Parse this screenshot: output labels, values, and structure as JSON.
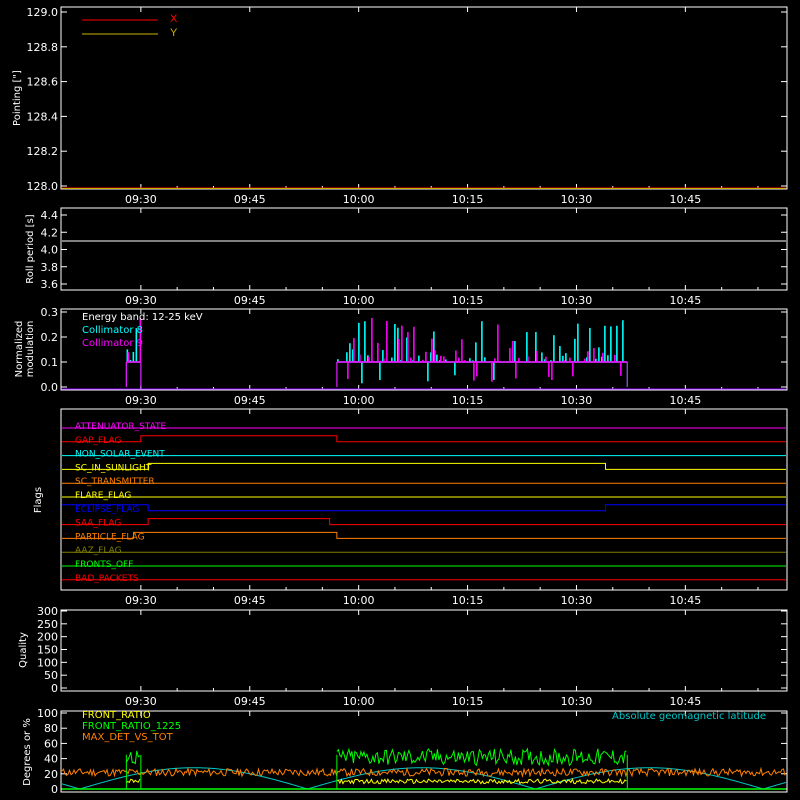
{
  "time_ticks": [
    "09:30",
    "09:45",
    "10:00",
    "10:15",
    "10:30",
    "10:45"
  ],
  "colors": {
    "x": "#ff0000",
    "y": "#c8b400",
    "roll": "#ffffff",
    "c8": "#00ffff",
    "c9": "#ff00ff",
    "base": "#8800ff",
    "fr": "#ffff00",
    "fr1225": "#00ff00",
    "maxdet": "#ff8000",
    "lat": "#00c8c8"
  },
  "chart_data": [
    {
      "type": "line",
      "ylabel": "Pointing [\"]",
      "ylim": [
        128.0,
        129.0
      ],
      "yticks": [
        "129.0",
        "128.8",
        "128.6",
        "128.4",
        "128.2",
        "128.0"
      ],
      "series": [
        {
          "name": "X",
          "color": "#ff0000",
          "x": [
            "09:19",
            "10:59"
          ],
          "y": [
            128.0,
            128.0
          ]
        },
        {
          "name": "Y",
          "color": "#c8b400",
          "x": [
            "09:19",
            "10:59"
          ],
          "y": [
            128.0,
            128.0
          ]
        }
      ]
    },
    {
      "type": "line",
      "ylabel": "Roll period [s]",
      "ylim": [
        3.5,
        4.5
      ],
      "yticks": [
        "4.4",
        "4.2",
        "4.0",
        "3.8",
        "3.6"
      ],
      "series": [
        {
          "x": [
            "09:19",
            "10:59"
          ],
          "y": [
            4.1,
            4.1
          ]
        }
      ]
    },
    {
      "type": "bar",
      "ylabel": "Normalized modulation",
      "ylim": [
        0.0,
        0.3
      ],
      "yticks": [
        "0.3",
        "0.2",
        "0.1",
        "0.0"
      ],
      "annotation": "Energy band: 12-25 keV",
      "series": [
        {
          "name": "Collimator 8",
          "color": "#00ffff",
          "segments": [
            [
              "09:28",
              "09:30"
            ],
            [
              "09:57",
              "10:37"
            ]
          ],
          "level": 0.1
        },
        {
          "name": "Collimator 9",
          "color": "#ff00ff",
          "segments": [
            [
              "09:28",
              "09:30"
            ],
            [
              "09:57",
              "10:37"
            ]
          ],
          "level": 0.1
        }
      ]
    },
    {
      "type": "line",
      "ylabel": "Flags",
      "flags": [
        {
          "name": "ATTENUATOR_STATE",
          "color": "#ff00ff",
          "high": []
        },
        {
          "name": "GAP_FLAG",
          "color": "#ff0000",
          "high": [
            [
              "09:30",
              "09:57"
            ]
          ]
        },
        {
          "name": "NON_SOLAR_EVENT",
          "color": "#00ffff",
          "high": []
        },
        {
          "name": "SC_IN_SUNLIGHT",
          "color": "#ffff00",
          "high": [
            [
              "09:31",
              "10:34"
            ]
          ]
        },
        {
          "name": "SC_TRANSMITTER",
          "color": "#ff8000",
          "high": []
        },
        {
          "name": "FLARE_FLAG",
          "color": "#ffff00",
          "high": []
        },
        {
          "name": "ECLIPSE_FLAG",
          "color": "#0000ff",
          "high": [
            [
              "09:19",
              "09:31"
            ],
            [
              "10:34",
              "10:59"
            ]
          ]
        },
        {
          "name": "SAA_FLAG",
          "color": "#ff0000",
          "high": [
            [
              "09:31",
              "09:56"
            ]
          ]
        },
        {
          "name": "PARTICLE_FLAG",
          "color": "#ff8000",
          "high": [
            [
              "09:29",
              "09:57"
            ]
          ]
        },
        {
          "name": "AAZ_FLAG",
          "color": "#808000",
          "high": []
        },
        {
          "name": "FRONTS_OFF",
          "color": "#00ff00",
          "high": []
        },
        {
          "name": "BAD_PACKETS",
          "color": "#ff0000",
          "high": []
        }
      ]
    },
    {
      "type": "line",
      "ylabel": "Quality",
      "ylim": [
        0,
        300
      ],
      "yticks": [
        "300",
        "250",
        "200",
        "150",
        "100",
        "50",
        "0"
      ],
      "series": []
    },
    {
      "type": "line",
      "ylabel": "Degrees or %",
      "ylim": [
        0,
        100
      ],
      "yticks": [
        "100",
        "80",
        "60",
        "40",
        "20",
        "0"
      ],
      "annotation": "Absolute geomagnetic latitude",
      "series": [
        {
          "name": "FRONT_RATIO",
          "color": "#ffff00",
          "level": 10
        },
        {
          "name": "FRONT_RATIO_1225",
          "color": "#00ff00",
          "level": 40
        },
        {
          "name": "MAX_DET_VS_TOT",
          "color": "#ff8000",
          "level": 22
        },
        {
          "name": "Absolute geomagnetic latitude",
          "color": "#00c8c8"
        }
      ]
    }
  ],
  "text": {
    "x_label": "X",
    "y_label": "Y",
    "energy_band": "Energy band: 12-25 keV",
    "collimator8": "Collimator 8",
    "collimator9": "Collimator 9",
    "pointing_ylabel": "Pointing [\"]",
    "roll_ylabel": "Roll period [s]",
    "mod_ylabel1": "Normalized",
    "mod_ylabel2": "modulation",
    "flags_ylabel": "Flags",
    "quality_ylabel": "Quality",
    "deg_ylabel": "Degrees or %",
    "front_ratio": "FRONT_RATIO",
    "front_ratio_1225": "FRONT_RATIO_1225",
    "max_det_vs_tot": "MAX_DET_VS_TOT",
    "geomag_lat": "Absolute geomagnetic latitude"
  }
}
